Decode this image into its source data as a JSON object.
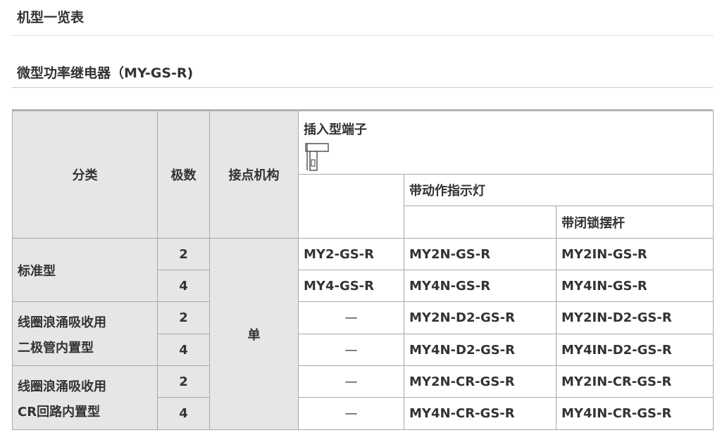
{
  "page_title": "机型一览表",
  "section_title": "微型功率继电器（MY-GS-R)",
  "table": {
    "headers": {
      "category": "分类",
      "poles": "极数",
      "contact": "接点机构",
      "plugin": "插入型端子",
      "indicator": "带动作指示灯",
      "latch": "带闭锁摆杆"
    },
    "contact_value": "单",
    "rows": [
      {
        "category_line1": "标准型",
        "poles": "2",
        "plugin": "MY2-GS-R",
        "indicator": "MY2N-GS-R",
        "latch": "MY2IN-GS-R"
      },
      {
        "poles": "4",
        "plugin": "MY4-GS-R",
        "indicator": "MY4N-GS-R",
        "latch": "MY4IN-GS-R"
      },
      {
        "category_line1": "线圈浪涌吸收用",
        "category_line2": "二极管内置型",
        "poles": "2",
        "plugin": "—",
        "indicator": "MY2N-D2-GS-R",
        "latch": "MY2IN-D2-GS-R"
      },
      {
        "poles": "4",
        "plugin": "—",
        "indicator": "MY4N-D2-GS-R",
        "latch": "MY4IN-D2-GS-R"
      },
      {
        "category_line1": "线圈浪涌吸收用",
        "category_line2": "CR回路内置型",
        "poles": "2",
        "plugin": "—",
        "indicator": "MY2N-CR-GS-R",
        "latch": "MY2IN-CR-GS-R"
      },
      {
        "poles": "4",
        "plugin": "—",
        "indicator": "MY4N-CR-GS-R",
        "latch": "MY4IN-CR-GS-R"
      }
    ]
  },
  "colors": {
    "header_bg": "#e6e6e6",
    "border": "#a9a9a9",
    "text": "#333333"
  }
}
